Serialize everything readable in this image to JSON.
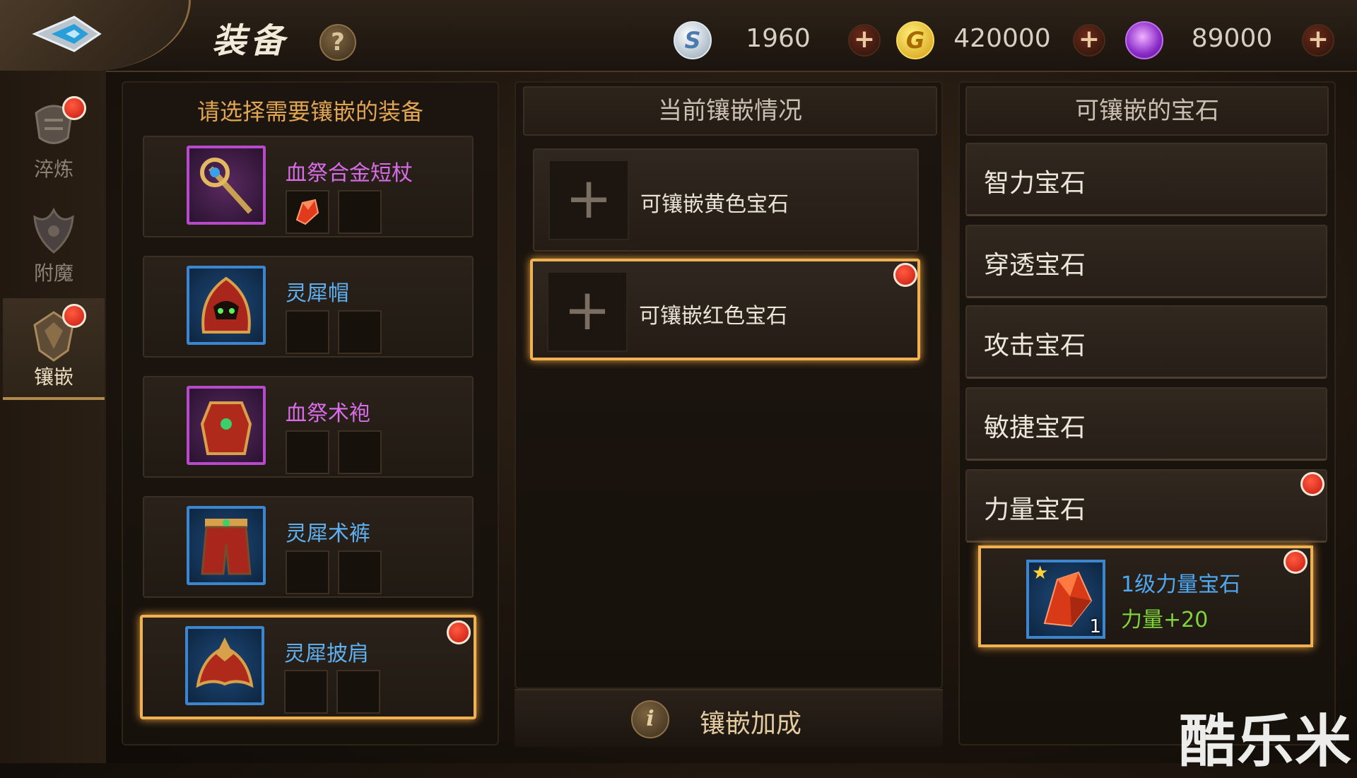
{
  "header": {
    "title": "装备",
    "help_icon": "?",
    "currencies": [
      {
        "name": "silver-coin",
        "icon_letter": "S",
        "value": "1960",
        "color": "#c9d4de"
      },
      {
        "name": "gold-coin",
        "icon_letter": "G",
        "value": "420000",
        "color": "#f0c02a"
      },
      {
        "name": "purple-gem",
        "icon_letter": "",
        "value": "89000",
        "color": "#b450e0"
      }
    ],
    "plus_symbol": "+"
  },
  "sidebar": {
    "items": [
      {
        "label": "淬炼",
        "active": false,
        "badge": true
      },
      {
        "label": "附魔",
        "active": false,
        "badge": false
      },
      {
        "label": "镶嵌",
        "active": true,
        "badge": true
      }
    ]
  },
  "equipment_panel": {
    "title": "请选择需要镶嵌的装备",
    "items": [
      {
        "name": "血祭合金短杖",
        "quality": "purple",
        "icon": "staff-icon",
        "slots": [
          "red-gem",
          "empty"
        ],
        "selected": false,
        "badge": false
      },
      {
        "name": "灵犀帽",
        "quality": "blue",
        "icon": "helmet-icon",
        "slots": [
          "empty",
          "empty"
        ],
        "selected": false,
        "badge": false
      },
      {
        "name": "血祭术袍",
        "quality": "purple",
        "icon": "robe-icon",
        "slots": [
          "empty",
          "empty"
        ],
        "selected": false,
        "badge": false
      },
      {
        "name": "灵犀术裤",
        "quality": "blue",
        "icon": "pants-icon",
        "slots": [
          "empty",
          "empty"
        ],
        "selected": false,
        "badge": false
      },
      {
        "name": "灵犀披肩",
        "quality": "blue",
        "icon": "shoulder-icon",
        "slots": [
          "empty",
          "empty"
        ],
        "selected": true,
        "badge": true
      }
    ]
  },
  "socket_panel": {
    "title": "当前镶嵌情况",
    "sockets": [
      {
        "label": "可镶嵌黄色宝石",
        "selected": false,
        "badge": false
      },
      {
        "label": "可镶嵌红色宝石",
        "selected": true,
        "badge": true
      }
    ],
    "bonus_label": "镶嵌加成",
    "info_icon": "i"
  },
  "gem_panel": {
    "title": "可镶嵌的宝石",
    "categories": [
      {
        "label": "智力宝石",
        "badge": false
      },
      {
        "label": "穿透宝石",
        "badge": false
      },
      {
        "label": "攻击宝石",
        "badge": false
      },
      {
        "label": "敏捷宝石",
        "badge": false
      },
      {
        "label": "力量宝石",
        "badge": true
      }
    ],
    "expanded_item": {
      "name": "1级力量宝石",
      "stat": "力量+20",
      "count": "1",
      "star": "★",
      "badge": true
    }
  },
  "watermark": "酷乐米"
}
